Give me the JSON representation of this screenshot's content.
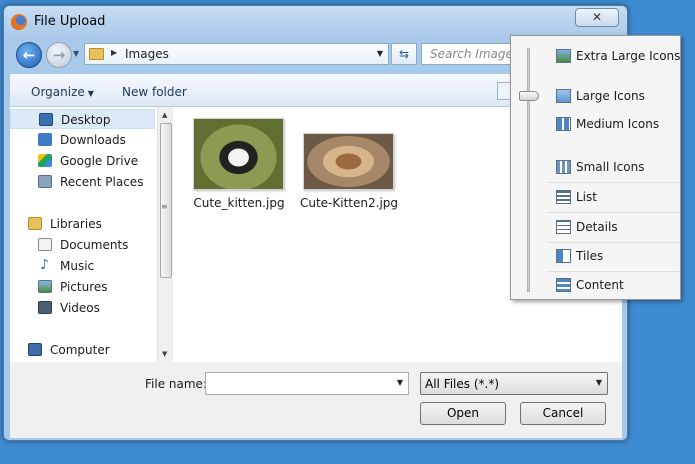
{
  "window": {
    "title": "File Upload",
    "close_glyph": "✕"
  },
  "address": {
    "breadcrumb": "Images",
    "search_placeholder": "Search Images"
  },
  "toolbar": {
    "organize": "Organize",
    "new_folder": "New folder"
  },
  "nav": {
    "items": [
      {
        "label": "Desktop",
        "icon": "desktop-icon",
        "selected": true
      },
      {
        "label": "Downloads",
        "icon": "downloads-icon"
      },
      {
        "label": "Google Drive",
        "icon": "google-drive-icon"
      },
      {
        "label": "Recent Places",
        "icon": "recent-places-icon"
      },
      {
        "label": "Libraries",
        "icon": "libraries-icon"
      },
      {
        "label": "Documents",
        "icon": "documents-icon"
      },
      {
        "label": "Music",
        "icon": "music-icon"
      },
      {
        "label": "Pictures",
        "icon": "pictures-icon"
      },
      {
        "label": "Videos",
        "icon": "videos-icon"
      },
      {
        "label": "Computer",
        "icon": "computer-icon"
      }
    ]
  },
  "files": [
    {
      "name": "Cute_kitten.jpg",
      "icon": "kitten-thumbnail"
    },
    {
      "name": "Cute-Kitten2.jpg",
      "icon": "kitten-thumbnail"
    }
  ],
  "bottom": {
    "file_name_label": "File name:",
    "file_name_value": "",
    "filter": "All Files (*.*)",
    "open": "Open",
    "cancel": "Cancel"
  },
  "view_menu": {
    "items": [
      {
        "label": "Extra Large Icons",
        "icon": "extra-large-icons-icon"
      },
      {
        "label": "Large Icons",
        "icon": "large-icons-icon"
      },
      {
        "label": "Medium Icons",
        "icon": "medium-icons-icon"
      },
      {
        "label": "Small Icons",
        "icon": "small-icons-icon"
      },
      {
        "label": "List",
        "icon": "list-icon"
      },
      {
        "label": "Details",
        "icon": "details-icon"
      },
      {
        "label": "Tiles",
        "icon": "tiles-icon"
      },
      {
        "label": "Content",
        "icon": "content-icon"
      }
    ]
  }
}
